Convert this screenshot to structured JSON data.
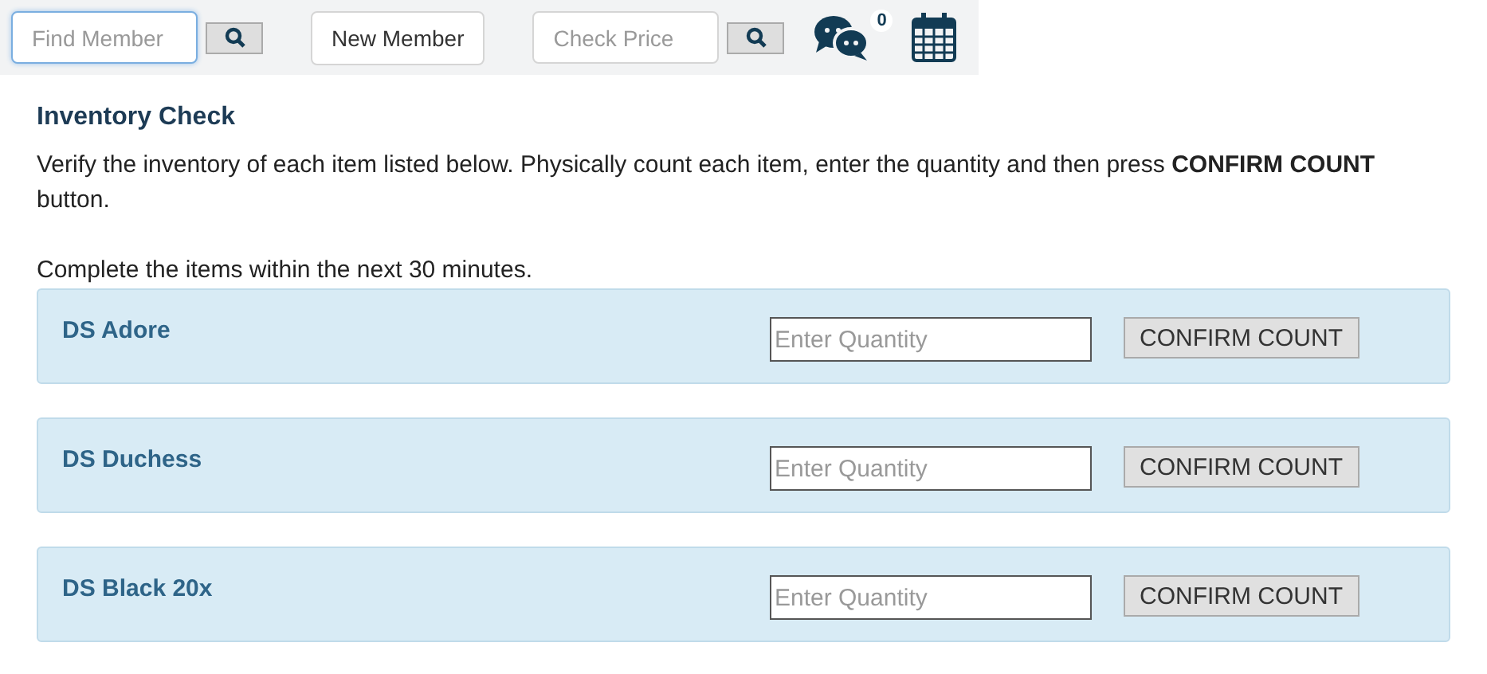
{
  "toolbar": {
    "find_member": {
      "placeholder": "Find Member",
      "focused": true
    },
    "new_member_button": "New Member",
    "check_price": {
      "placeholder": "Check Price",
      "focused": false
    },
    "chat_badge": "0"
  },
  "section": {
    "title": "Inventory Check",
    "instructions": "Verify the inventory of each item listed below. Physically count each item, enter the quantity and then press **CONFIRM COUNT** button.",
    "deadline": "Complete the items within the next 30 minutes."
  },
  "items": [
    {
      "name": "DS Adore",
      "quantity_placeholder": "Enter Quantity",
      "button": "CONFIRM COUNT"
    },
    {
      "name": "DS Duchess",
      "quantity_placeholder": "Enter Quantity",
      "button": "CONFIRM COUNT"
    },
    {
      "name": "DS Black 20x",
      "quantity_placeholder": "Enter Quantity",
      "button": "CONFIRM COUNT"
    }
  ]
}
